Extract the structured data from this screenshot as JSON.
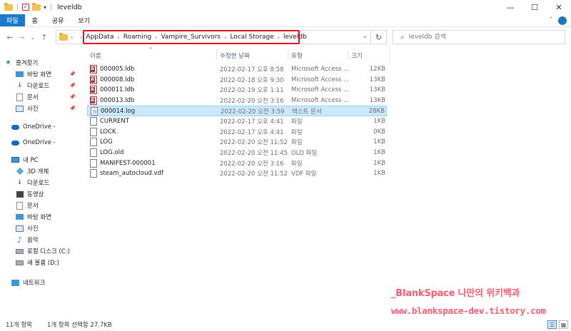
{
  "window": {
    "title": "leveldb",
    "controls": [
      "—",
      "☐",
      "✕"
    ]
  },
  "ribbon": {
    "tabs": [
      "파일",
      "홈",
      "공유",
      "보기"
    ],
    "right": {
      "collapse": "ˇ",
      "help": "?"
    }
  },
  "nav": {
    "breadcrumb": [
      "AppData",
      "Roaming",
      "Vampire_Survivors",
      "Local Storage",
      "leveldb"
    ],
    "search_placeholder": "leveldb 검색"
  },
  "sidebar": {
    "quick_access": "즐겨찾기",
    "items": [
      {
        "label": "바탕 화면",
        "icon": "desktop-icon",
        "pinned": true
      },
      {
        "label": "다운로드",
        "icon": "download-icon",
        "pinned": true
      },
      {
        "label": "문서",
        "icon": "document-icon",
        "pinned": true
      },
      {
        "label": "사진",
        "icon": "picture-icon",
        "pinned": true
      }
    ],
    "onedrive": [
      "OneDrive -",
      "OneDrive -"
    ],
    "this_pc": "내 PC",
    "pc_items": [
      {
        "label": "3D 개체",
        "icon": "3d-objects-icon"
      },
      {
        "label": "다운로드",
        "icon": "download-icon"
      },
      {
        "label": "동영상",
        "icon": "video-icon"
      },
      {
        "label": "문서",
        "icon": "document-icon"
      },
      {
        "label": "바탕 화면",
        "icon": "desktop-icon"
      },
      {
        "label": "사진",
        "icon": "picture-icon"
      },
      {
        "label": "음악",
        "icon": "music-icon"
      },
      {
        "label": "로컬 디스크 (C:)",
        "icon": "drive-icon"
      },
      {
        "label": "새 볼륨 (D:)",
        "icon": "drive-icon"
      }
    ],
    "network": "네트워크"
  },
  "columns": [
    "이름",
    "수정한 날짜",
    "유형",
    "크기"
  ],
  "files": [
    {
      "name": "000005.ldb",
      "date": "2022-02-17 오후 8:58",
      "type": "Microsoft Access ...",
      "size": "12KB",
      "icon": "access-file-icon"
    },
    {
      "name": "000008.ldb",
      "date": "2022-02-18 오후 9:30",
      "type": "Microsoft Access ...",
      "size": "13KB",
      "icon": "access-file-icon"
    },
    {
      "name": "000011.ldb",
      "date": "2022-02-19 오후 1:11",
      "type": "Microsoft Access ...",
      "size": "13KB",
      "icon": "access-file-icon"
    },
    {
      "name": "000013.ldb",
      "date": "2022-02-20 오전 3:16",
      "type": "Microsoft Access ...",
      "size": "13KB",
      "icon": "access-file-icon"
    },
    {
      "name": "000014.log",
      "date": "2022-02-20 오전 3:59",
      "type": "텍스트 문서",
      "size": "28KB",
      "icon": "text-file-icon",
      "selected": true
    },
    {
      "name": "CURRENT",
      "date": "2022-02-17 오후 4:41",
      "type": "파일",
      "size": "1KB",
      "icon": "file-icon"
    },
    {
      "name": "LOCK",
      "date": "2022-02-17 오후 4:41",
      "type": "파일",
      "size": "0KB",
      "icon": "file-icon"
    },
    {
      "name": "LOG",
      "date": "2022-02-20 오전 11:52",
      "type": "파일",
      "size": "1KB",
      "icon": "file-icon"
    },
    {
      "name": "LOG.old",
      "date": "2022-02-20 오전 11:45",
      "type": "OLD 파일",
      "size": "1KB",
      "icon": "file-icon"
    },
    {
      "name": "MANIFEST-000001",
      "date": "2022-02-20 오전 3:16",
      "type": "파일",
      "size": "1KB",
      "icon": "file-icon"
    },
    {
      "name": "steam_autocloud.vdf",
      "date": "2022-02-20 오전 11:52",
      "type": "VDF 파일",
      "size": "1KB",
      "icon": "file-icon"
    }
  ],
  "status": {
    "count": "11개 항목",
    "selection": "1개 항목 선택함 27.7KB"
  },
  "watermark": {
    "line1": "_BlankSpace 나만의 위키백과",
    "line2": "www.blankspace-dev.tistory.com"
  },
  "colors": {
    "accent": "#1979ca",
    "selection": "#cce8ff",
    "highlight_box": "#e0121f",
    "watermark": "#ff5a6e"
  }
}
